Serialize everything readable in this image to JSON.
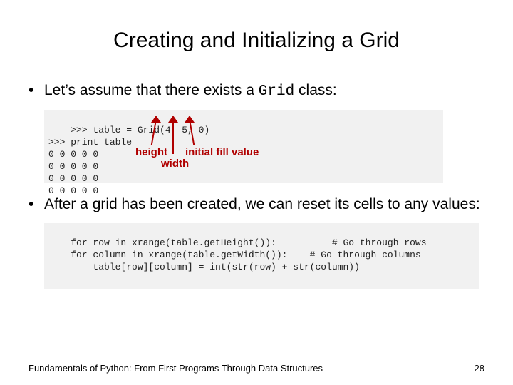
{
  "title": "Creating and Initializing a Grid",
  "bullet1_prefix": "Let’s assume that there exists a ",
  "bullet1_code": "Grid",
  "bullet1_suffix": " class:",
  "code1": ">>> table = Grid(4, 5, 0)\n>>> print table\n0 0 0 0 0\n0 0 0 0 0\n0 0 0 0 0\n0 0 0 0 0",
  "annot_height": "height",
  "annot_width": "width",
  "annot_fill": "initial fill value",
  "bullet2": "After a grid has been created, we can reset its cells to any values:",
  "code2": "for row in xrange(table.getHeight()):          # Go through rows\n    for column in xrange(table.getWidth()):    # Go through columns\n        table[row][column] = int(str(row) + str(column))",
  "footer_left": "Fundamentals of Python: From First Programs Through Data Structures",
  "footer_right": "28"
}
